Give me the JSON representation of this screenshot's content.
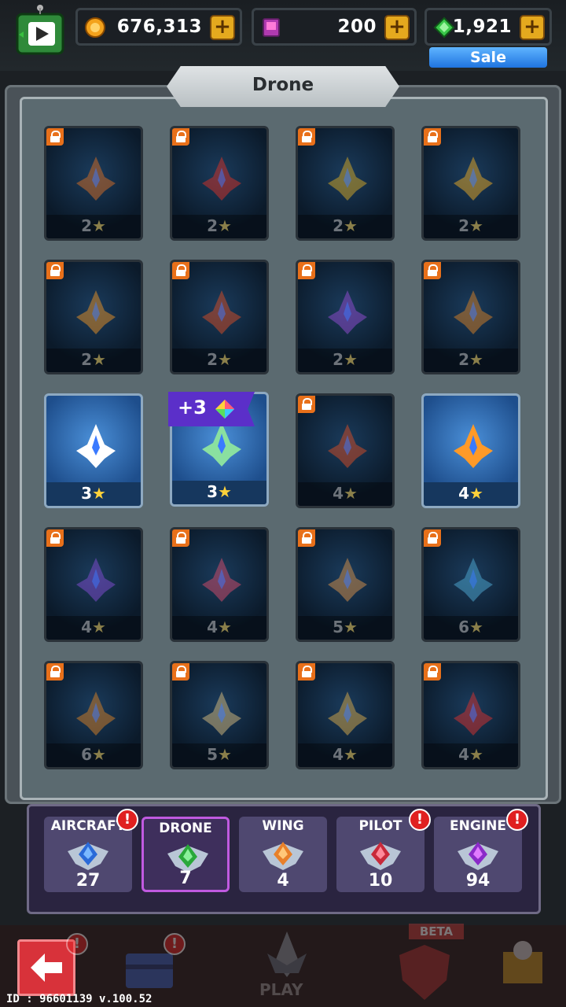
{
  "currency": {
    "coins": "676,313",
    "cards": "200",
    "gems": "1,921",
    "sale_label": "Sale"
  },
  "panel_title": "Drone",
  "drones": [
    {
      "stars": "2",
      "locked": true
    },
    {
      "stars": "2",
      "locked": true
    },
    {
      "stars": "2",
      "locked": true
    },
    {
      "stars": "2",
      "locked": true
    },
    {
      "stars": "2",
      "locked": true
    },
    {
      "stars": "2",
      "locked": true
    },
    {
      "stars": "2",
      "locked": true
    },
    {
      "stars": "2",
      "locked": true
    },
    {
      "stars": "3",
      "locked": false
    },
    {
      "stars": "3",
      "locked": false
    },
    {
      "stars": "4",
      "locked": true
    },
    {
      "stars": "4",
      "locked": false
    },
    {
      "stars": "4",
      "locked": true
    },
    {
      "stars": "4",
      "locked": true
    },
    {
      "stars": "5",
      "locked": true
    },
    {
      "stars": "6",
      "locked": true
    },
    {
      "stars": "6",
      "locked": true
    },
    {
      "stars": "5",
      "locked": true
    },
    {
      "stars": "4",
      "locked": true
    },
    {
      "stars": "4",
      "locked": true
    }
  ],
  "reward_badge": "+3",
  "tabs": [
    {
      "label": "AIRCRAFT",
      "count": "27",
      "alert": true
    },
    {
      "label": "DRONE",
      "count": "7",
      "alert": false
    },
    {
      "label": "WING",
      "count": "4",
      "alert": false
    },
    {
      "label": "PILOT",
      "count": "10",
      "alert": true
    },
    {
      "label": "ENGINE",
      "count": "94",
      "alert": true
    }
  ],
  "bottom_nav": {
    "play_label": "PLAY",
    "beta_label": "BETA"
  },
  "footer_id": "ID : 96601139 v.100.52",
  "colors": {
    "accent_purple": "#5b2fc9",
    "coin_gold": "#e5a91e",
    "sale_blue": "#1f74e0",
    "back_red": "#d8323a"
  }
}
